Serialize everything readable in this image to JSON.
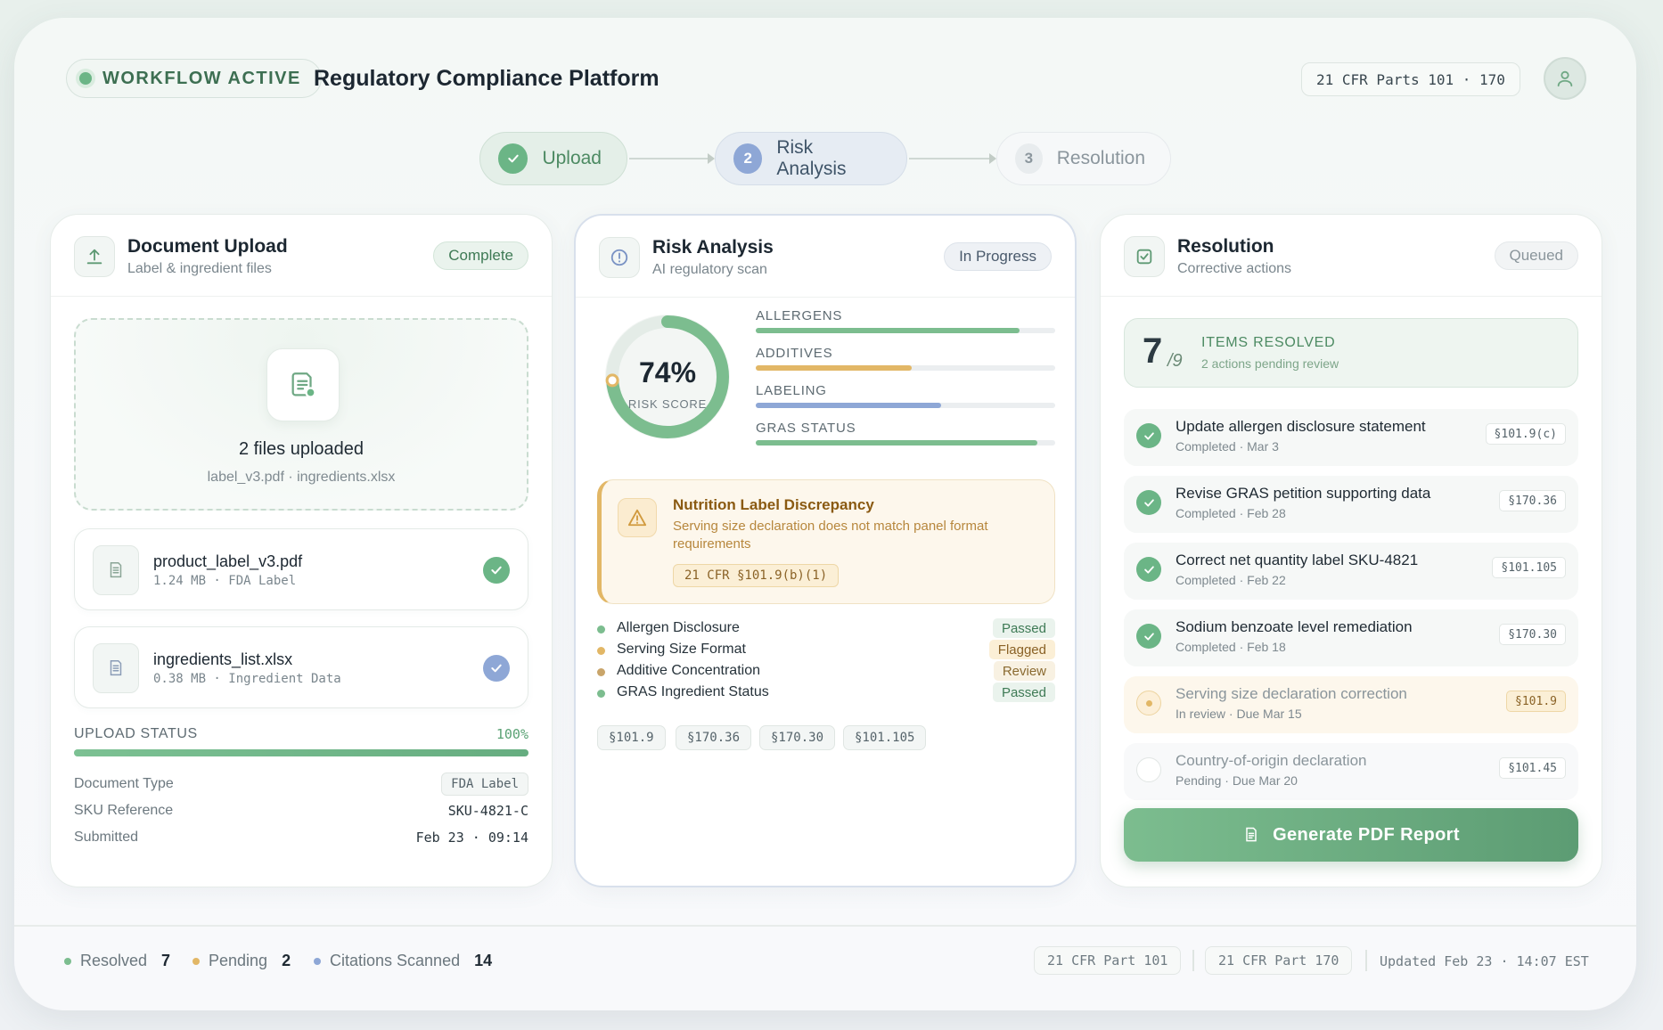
{
  "header": {
    "workflow_status": "WORKFLOW ACTIVE",
    "title": "Regulatory Compliance Platform",
    "cfr_range": "21 CFR Parts 101 · 170",
    "avatar_icon": "user-icon"
  },
  "stepper": {
    "steps": [
      {
        "num": "✓",
        "label": "Upload",
        "state": "done"
      },
      {
        "num": "2",
        "label": "Risk Analysis",
        "state": "active"
      },
      {
        "num": "3",
        "label": "Resolution",
        "state": "pending"
      }
    ]
  },
  "upload_card": {
    "title": "Document Upload",
    "subtitle": "Label & ingredient files",
    "badge": "Complete",
    "dropzone_title": "2 files uploaded",
    "dropzone_sub": "label_v3.pdf · ingredients.xlsx",
    "files": [
      {
        "name": "product_label_v3.pdf",
        "meta": "1.24 MB · FDA Label",
        "check_color": "#6bb586"
      },
      {
        "name": "ingredients_list.xlsx",
        "meta": "0.38 MB · Ingredient Data",
        "check_color": "#8ea7d6"
      }
    ],
    "upload_status_label": "UPLOAD STATUS",
    "upload_status_value": "100%",
    "upload_progress": 1.0,
    "meta": [
      {
        "label": "Document Type",
        "value": "FDA Label"
      },
      {
        "label": "SKU Reference",
        "value": "SKU-4821-C"
      },
      {
        "label": "Submitted",
        "value": "Feb 23 · 09:14"
      }
    ]
  },
  "risk_card": {
    "title": "Risk Analysis",
    "subtitle": "AI regulatory scan",
    "badge": "In Progress",
    "score_value": "74%",
    "score_label": "RISK SCORE",
    "score_fraction": 0.74,
    "metrics": [
      {
        "label": "ALLERGENS",
        "fraction": 0.88,
        "color": "#7cbd8f"
      },
      {
        "label": "ADDITIVES",
        "fraction": 0.52,
        "color": "#e2b766"
      },
      {
        "label": "LABELING",
        "fraction": 0.62,
        "color": "#8ea7d6"
      },
      {
        "label": "GRAS STATUS",
        "fraction": 0.94,
        "color": "#7cbd8f"
      }
    ],
    "alert": {
      "title": "Nutrition Label Discrepancy",
      "description": "Serving size declaration does not match panel format requirements",
      "citation": "21 CFR §101.9(b)(1)"
    },
    "checks": [
      {
        "label": "Allergen Disclosure",
        "status": "Passed",
        "dot": "#7cbd8f",
        "bg": "#eaf3ed",
        "fg": "#3e7a55"
      },
      {
        "label": "Serving Size Format",
        "status": "Flagged",
        "dot": "#e2b766",
        "bg": "#fbefd6",
        "fg": "#8a6226"
      },
      {
        "label": "Additive Concentration",
        "status": "Review",
        "dot": "#c9a56a",
        "bg": "#f8f1e2",
        "fg": "#8a6a30"
      },
      {
        "label": "GRAS Ingredient Status",
        "status": "Passed",
        "dot": "#7cbd8f",
        "bg": "#eaf3ed",
        "fg": "#3e7a55"
      }
    ],
    "citations": [
      "§101.9",
      "§170.36",
      "§170.30",
      "§101.105"
    ]
  },
  "resolution_card": {
    "title": "Resolution",
    "subtitle": "Corrective actions",
    "badge": "Queued",
    "resolved_count": "7",
    "resolved_total": "/9",
    "resolved_label": "ITEMS RESOLVED",
    "resolved_sub": "2 actions pending review",
    "actions": [
      {
        "title": "Update allergen disclosure statement",
        "sub": "Completed · Mar 3",
        "cite": "§101.9(c)",
        "state": "done"
      },
      {
        "title": "Revise GRAS petition supporting data",
        "sub": "Completed · Feb 28",
        "cite": "§170.36",
        "state": "done"
      },
      {
        "title": "Correct net quantity label SKU-4821",
        "sub": "Completed · Feb 22",
        "cite": "§101.105",
        "state": "done"
      },
      {
        "title": "Sodium benzoate level remediation",
        "sub": "Completed · Feb 18",
        "cite": "§170.30",
        "state": "done"
      },
      {
        "title": "Serving size declaration correction",
        "sub": "In review · Due Mar 15",
        "cite": "§101.9",
        "state": "review"
      },
      {
        "title": "Country-of-origin declaration",
        "sub": "Pending · Due Mar 20",
        "cite": "§101.45",
        "state": "pending"
      }
    ],
    "button_label": "Generate PDF Report"
  },
  "footer": {
    "resolved_label": "Resolved",
    "resolved_value": "7",
    "pending_label": "Pending",
    "pending_value": "2",
    "citations_label": "Citations Scanned",
    "citations_value": "14",
    "part_101": "21 CFR Part 101",
    "part_170": "21 CFR Part 170",
    "updated": "Updated Feb 23 · 14:07 EST"
  }
}
